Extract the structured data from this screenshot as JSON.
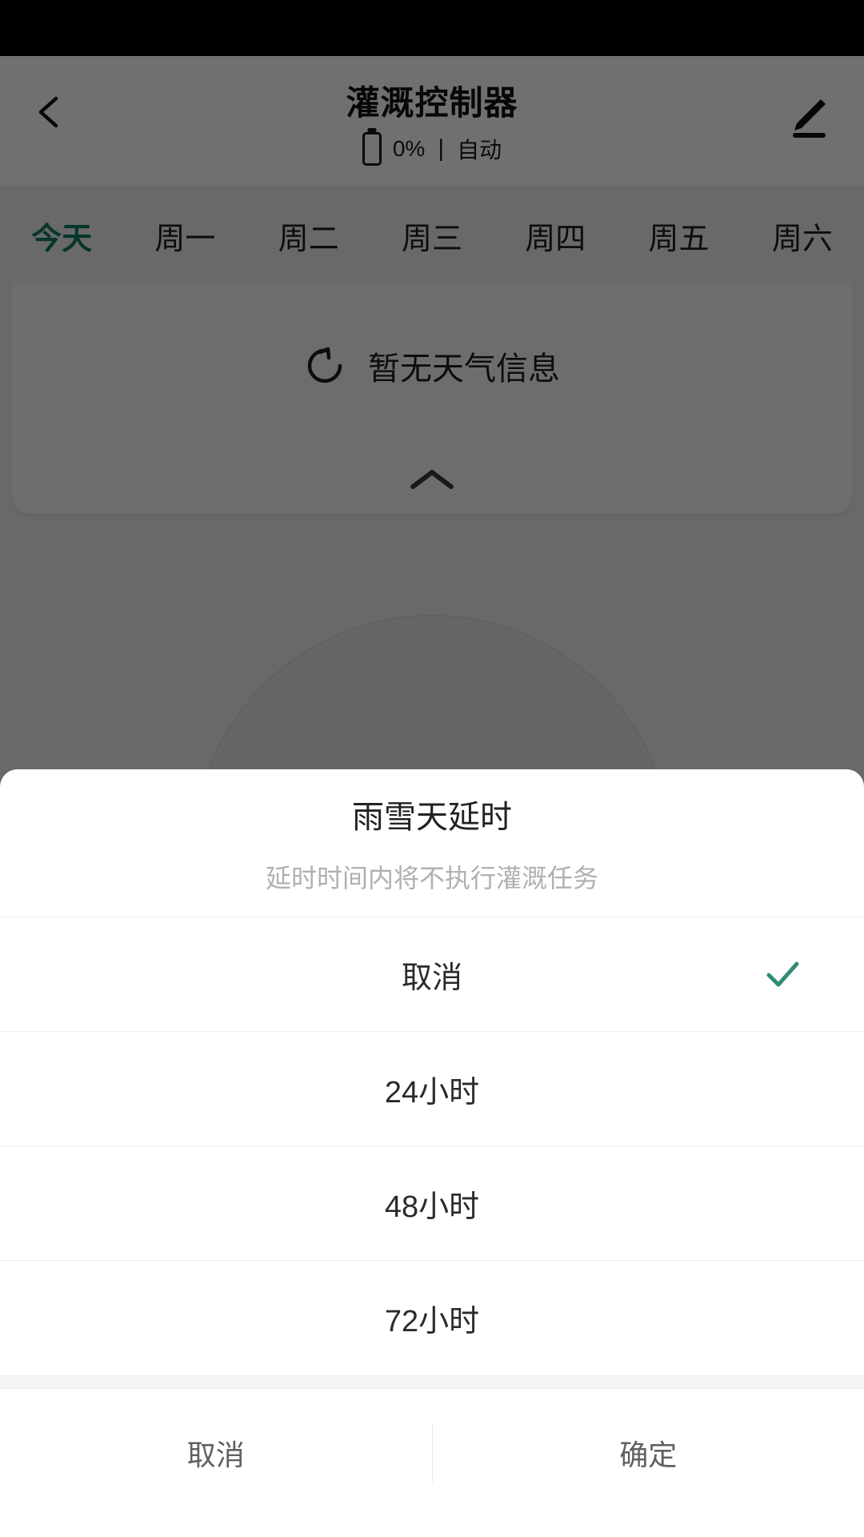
{
  "app": {
    "title": "灌溉控制器",
    "battery_percent": "0%",
    "separator": "|",
    "mode": "自动",
    "back_icon": "back-chevron-icon",
    "edit_icon": "pencil-edit-icon"
  },
  "day_tabs": [
    {
      "label": "今天",
      "active": true
    },
    {
      "label": "周一",
      "active": false
    },
    {
      "label": "周二",
      "active": false
    },
    {
      "label": "周三",
      "active": false
    },
    {
      "label": "周四",
      "active": false
    },
    {
      "label": "周五",
      "active": false
    },
    {
      "label": "周六",
      "active": false
    }
  ],
  "weather": {
    "message": "暂无天气信息",
    "refresh_icon": "refresh-icon",
    "collapse_icon": "chevron-up-icon"
  },
  "sheet": {
    "title": "雨雪天延时",
    "subtitle": "延时时间内将不执行灌溉任务",
    "options": [
      {
        "label": "取消",
        "selected": true
      },
      {
        "label": "24小时",
        "selected": false
      },
      {
        "label": "48小时",
        "selected": false
      },
      {
        "label": "72小时",
        "selected": false
      }
    ],
    "cancel_label": "取消",
    "confirm_label": "确定"
  },
  "colors": {
    "accent": "#2f8c75",
    "tab_active": "#0f7a62",
    "scrim": "rgba(0,0,0,0.56)",
    "status_bar": "#000000"
  }
}
